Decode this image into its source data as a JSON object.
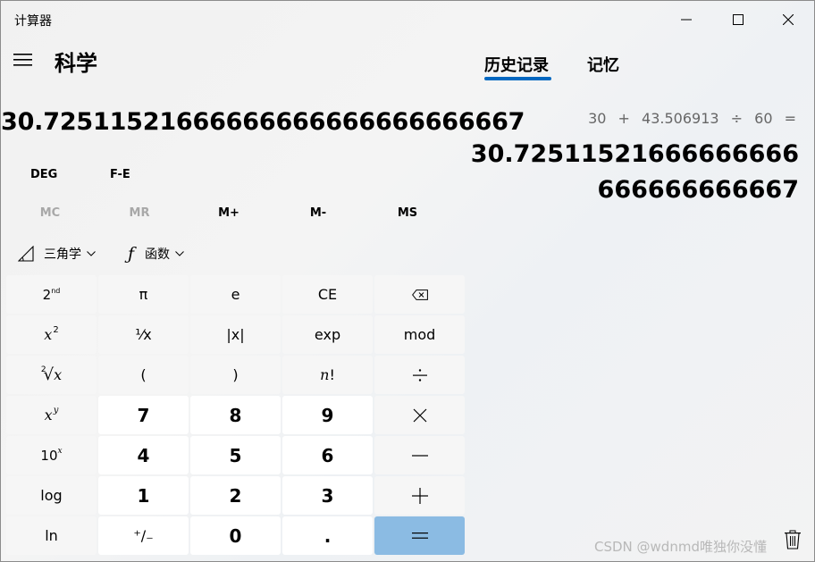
{
  "window": {
    "title": "计算器"
  },
  "header": {
    "mode_title": "科学"
  },
  "tabs": [
    {
      "label": "历史记录",
      "active": true
    },
    {
      "label": "记忆",
      "active": false
    }
  ],
  "display": {
    "value": "30.72511521666666666666666666667"
  },
  "toggles": {
    "angle": "DEG",
    "notation": "F-E"
  },
  "memory": [
    {
      "label": "MC",
      "enabled": false
    },
    {
      "label": "MR",
      "enabled": false
    },
    {
      "label": "M+",
      "enabled": true
    },
    {
      "label": "M-",
      "enabled": true
    },
    {
      "label": "MS",
      "enabled": true
    }
  ],
  "dropdowns": {
    "trig": "三角学",
    "func": "函数"
  },
  "keys": {
    "second": "2nd",
    "pi": "π",
    "e": "e",
    "ce": "CE",
    "mod": "mod",
    "exp": "exp",
    "lparen": "(",
    "rparen": ")",
    "n": "n",
    "excl": "!",
    "seven": "7",
    "eight": "8",
    "nine": "9",
    "four": "4",
    "five": "5",
    "six": "6",
    "one": "1",
    "two": "2",
    "three": "3",
    "zero": "0",
    "dot": ".",
    "log": "log",
    "ln": "ln",
    "x": "x",
    "y": "y",
    "two_sup": "2",
    "ten": "10",
    "one_slash_x": "¹⁄x",
    "abs_x": "|x|",
    "plus_minus": "⁺/₋",
    "nd": "nd"
  },
  "history": {
    "expression": "30 + 43.506913 ÷ 60 =",
    "result": "30.72511521666666666666666666667"
  },
  "watermark": "CSDN @wdnmd唯独你没懂",
  "colors": {
    "accent": "#0067c0",
    "equals": "#8bbbe3"
  }
}
